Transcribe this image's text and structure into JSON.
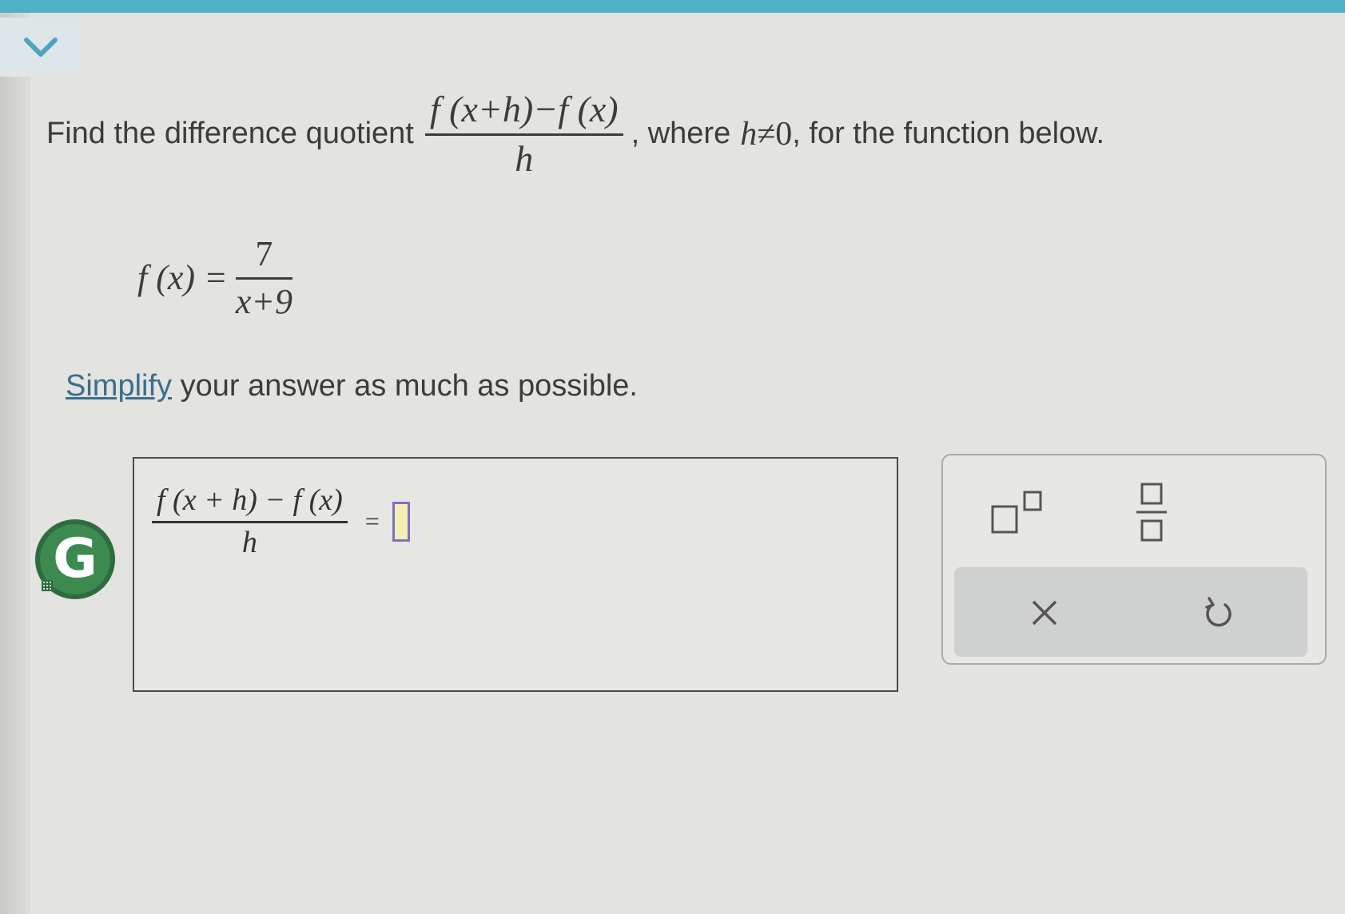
{
  "question": {
    "intro": "Find the difference quotient",
    "quotient_numerator": "f (x+h)−f (x)",
    "quotient_denominator": "h",
    "where_text": ", where",
    "condition_var": "h",
    "condition_rel": "≠",
    "condition_value": "0",
    "tail": ", for the function below."
  },
  "function": {
    "lhs": "f (x) =",
    "numerator": "7",
    "denominator": "x+9"
  },
  "instructions": {
    "link": "Simplify",
    "rest": " your answer as much as possible."
  },
  "answer": {
    "numerator": "f (x + h) − f (x)",
    "denominator": "h",
    "equals": "=",
    "value": ""
  },
  "badge": {
    "letter": "G"
  },
  "palette": {
    "buttons": [
      "superscript-icon",
      "fraction-icon"
    ],
    "actions": [
      "clear-icon",
      "undo-icon"
    ]
  },
  "colors": {
    "top_strip": "#4fb0c6",
    "link": "#3a6f8c",
    "input_border": "#7c70c8",
    "input_fill": "#f4efb2",
    "badge": "#3c8a50"
  }
}
